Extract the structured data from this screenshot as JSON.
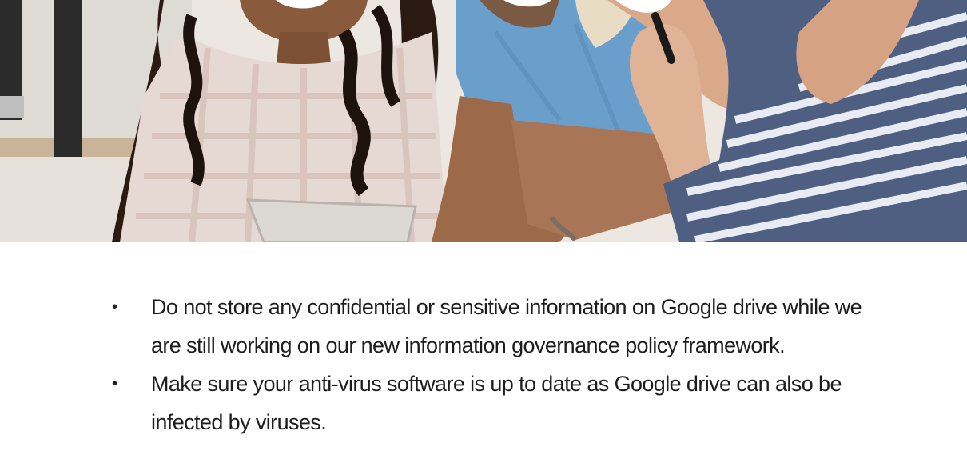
{
  "hero_image": {
    "description": "photo-of-three-people-looking-at-tablet"
  },
  "bullets": {
    "symbol": "•",
    "items": [
      {
        "text": " Do not store any confidential or sensitive information on Google drive while we are still working on our new information governance policy framework."
      },
      {
        "text": "Make sure your anti-virus software is up to date as Google drive can also be infected by viruses."
      }
    ]
  }
}
